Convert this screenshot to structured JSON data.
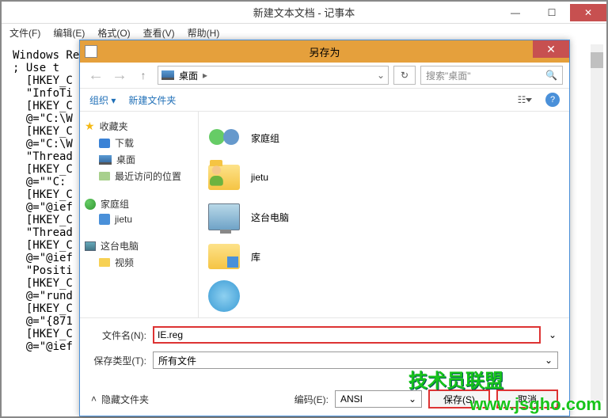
{
  "notepad": {
    "title": "新建文本文档 - 记事本",
    "menu": {
      "file": "文件(F)",
      "edit": "编辑(E)",
      "format": "格式(O)",
      "view": "查看(V)",
      "help": "帮助(H)"
    },
    "text": "Windows Reg\n; Use t\n  [HKEY_C\n  \"InfoTi\n  [HKEY_C\n  @=\"C:\\W\n  [HKEY_C\n  @=\"C:\\W\n  \"Thread\n  [HKEY_C\n  @=\"\"C:\n  [HKEY_C\n  @=\"@ief\n  [HKEY_C\n  \"Thread\n  [HKEY_C\n  @=\"@ief\n  \"Positi\n  [HKEY_C\n  @=\"rund\n  [HKEY_C\n  @=\"{871\n  [HKEY_C\n  @=\"@ief"
  },
  "dialog": {
    "title": "另存为",
    "nav": {
      "location": "桌面",
      "locationChevron": "▸",
      "refresh": "↻",
      "searchPlaceholder": "搜索\"桌面\"",
      "searchIcon": "🔍"
    },
    "toolbar": {
      "organize": "组织",
      "organizeArrow": "▾",
      "newFolder": "新建文件夹",
      "help": "?"
    },
    "navPane": {
      "favorites": {
        "label": "收藏夹",
        "items": [
          {
            "label": "下载"
          },
          {
            "label": "桌面"
          },
          {
            "label": "最近访问的位置"
          }
        ]
      },
      "homegroup": {
        "label": "家庭组",
        "items": [
          {
            "label": "jietu"
          }
        ]
      },
      "thisPC": {
        "label": "这台电脑",
        "items": [
          {
            "label": "视频"
          }
        ]
      }
    },
    "items": [
      {
        "label": "家庭组"
      },
      {
        "label": "jietu"
      },
      {
        "label": "这台电脑"
      },
      {
        "label": "库"
      },
      {
        "label": ""
      }
    ],
    "fileName": {
      "label": "文件名(N):",
      "value": "IE.reg"
    },
    "fileType": {
      "label": "保存类型(T):",
      "value": "所有文件"
    },
    "hideFolders": "隐藏文件夹",
    "encoding": {
      "label": "编码(E):",
      "value": "ANSI"
    },
    "buttons": {
      "save": "保存(S)",
      "cancel": "取消"
    }
  },
  "watermark": {
    "a": "技术员联盟",
    "b": "www.jsgho.com"
  }
}
